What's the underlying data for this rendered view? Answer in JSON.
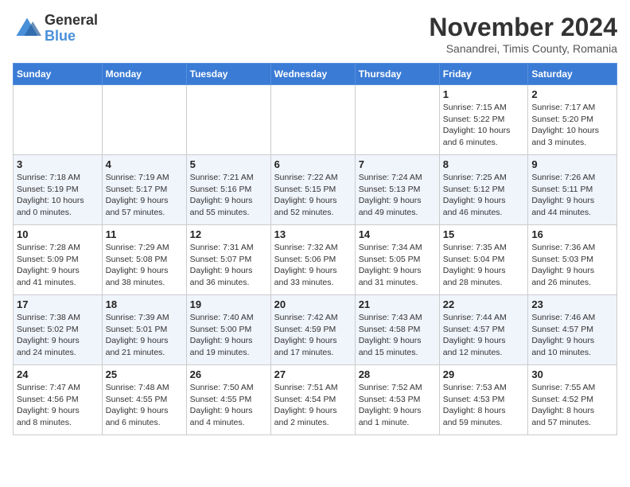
{
  "logo": {
    "general": "General",
    "blue": "Blue"
  },
  "title": "November 2024",
  "location": "Sanandrei, Timis County, Romania",
  "weekdays": [
    "Sunday",
    "Monday",
    "Tuesday",
    "Wednesday",
    "Thursday",
    "Friday",
    "Saturday"
  ],
  "weeks": [
    [
      {
        "day": "",
        "info": ""
      },
      {
        "day": "",
        "info": ""
      },
      {
        "day": "",
        "info": ""
      },
      {
        "day": "",
        "info": ""
      },
      {
        "day": "",
        "info": ""
      },
      {
        "day": "1",
        "info": "Sunrise: 7:15 AM\nSunset: 5:22 PM\nDaylight: 10 hours\nand 6 minutes."
      },
      {
        "day": "2",
        "info": "Sunrise: 7:17 AM\nSunset: 5:20 PM\nDaylight: 10 hours\nand 3 minutes."
      }
    ],
    [
      {
        "day": "3",
        "info": "Sunrise: 7:18 AM\nSunset: 5:19 PM\nDaylight: 10 hours\nand 0 minutes."
      },
      {
        "day": "4",
        "info": "Sunrise: 7:19 AM\nSunset: 5:17 PM\nDaylight: 9 hours\nand 57 minutes."
      },
      {
        "day": "5",
        "info": "Sunrise: 7:21 AM\nSunset: 5:16 PM\nDaylight: 9 hours\nand 55 minutes."
      },
      {
        "day": "6",
        "info": "Sunrise: 7:22 AM\nSunset: 5:15 PM\nDaylight: 9 hours\nand 52 minutes."
      },
      {
        "day": "7",
        "info": "Sunrise: 7:24 AM\nSunset: 5:13 PM\nDaylight: 9 hours\nand 49 minutes."
      },
      {
        "day": "8",
        "info": "Sunrise: 7:25 AM\nSunset: 5:12 PM\nDaylight: 9 hours\nand 46 minutes."
      },
      {
        "day": "9",
        "info": "Sunrise: 7:26 AM\nSunset: 5:11 PM\nDaylight: 9 hours\nand 44 minutes."
      }
    ],
    [
      {
        "day": "10",
        "info": "Sunrise: 7:28 AM\nSunset: 5:09 PM\nDaylight: 9 hours\nand 41 minutes."
      },
      {
        "day": "11",
        "info": "Sunrise: 7:29 AM\nSunset: 5:08 PM\nDaylight: 9 hours\nand 38 minutes."
      },
      {
        "day": "12",
        "info": "Sunrise: 7:31 AM\nSunset: 5:07 PM\nDaylight: 9 hours\nand 36 minutes."
      },
      {
        "day": "13",
        "info": "Sunrise: 7:32 AM\nSunset: 5:06 PM\nDaylight: 9 hours\nand 33 minutes."
      },
      {
        "day": "14",
        "info": "Sunrise: 7:34 AM\nSunset: 5:05 PM\nDaylight: 9 hours\nand 31 minutes."
      },
      {
        "day": "15",
        "info": "Sunrise: 7:35 AM\nSunset: 5:04 PM\nDaylight: 9 hours\nand 28 minutes."
      },
      {
        "day": "16",
        "info": "Sunrise: 7:36 AM\nSunset: 5:03 PM\nDaylight: 9 hours\nand 26 minutes."
      }
    ],
    [
      {
        "day": "17",
        "info": "Sunrise: 7:38 AM\nSunset: 5:02 PM\nDaylight: 9 hours\nand 24 minutes."
      },
      {
        "day": "18",
        "info": "Sunrise: 7:39 AM\nSunset: 5:01 PM\nDaylight: 9 hours\nand 21 minutes."
      },
      {
        "day": "19",
        "info": "Sunrise: 7:40 AM\nSunset: 5:00 PM\nDaylight: 9 hours\nand 19 minutes."
      },
      {
        "day": "20",
        "info": "Sunrise: 7:42 AM\nSunset: 4:59 PM\nDaylight: 9 hours\nand 17 minutes."
      },
      {
        "day": "21",
        "info": "Sunrise: 7:43 AM\nSunset: 4:58 PM\nDaylight: 9 hours\nand 15 minutes."
      },
      {
        "day": "22",
        "info": "Sunrise: 7:44 AM\nSunset: 4:57 PM\nDaylight: 9 hours\nand 12 minutes."
      },
      {
        "day": "23",
        "info": "Sunrise: 7:46 AM\nSunset: 4:57 PM\nDaylight: 9 hours\nand 10 minutes."
      }
    ],
    [
      {
        "day": "24",
        "info": "Sunrise: 7:47 AM\nSunset: 4:56 PM\nDaylight: 9 hours\nand 8 minutes."
      },
      {
        "day": "25",
        "info": "Sunrise: 7:48 AM\nSunset: 4:55 PM\nDaylight: 9 hours\nand 6 minutes."
      },
      {
        "day": "26",
        "info": "Sunrise: 7:50 AM\nSunset: 4:55 PM\nDaylight: 9 hours\nand 4 minutes."
      },
      {
        "day": "27",
        "info": "Sunrise: 7:51 AM\nSunset: 4:54 PM\nDaylight: 9 hours\nand 2 minutes."
      },
      {
        "day": "28",
        "info": "Sunrise: 7:52 AM\nSunset: 4:53 PM\nDaylight: 9 hours\nand 1 minute."
      },
      {
        "day": "29",
        "info": "Sunrise: 7:53 AM\nSunset: 4:53 PM\nDaylight: 8 hours\nand 59 minutes."
      },
      {
        "day": "30",
        "info": "Sunrise: 7:55 AM\nSunset: 4:52 PM\nDaylight: 8 hours\nand 57 minutes."
      }
    ]
  ]
}
